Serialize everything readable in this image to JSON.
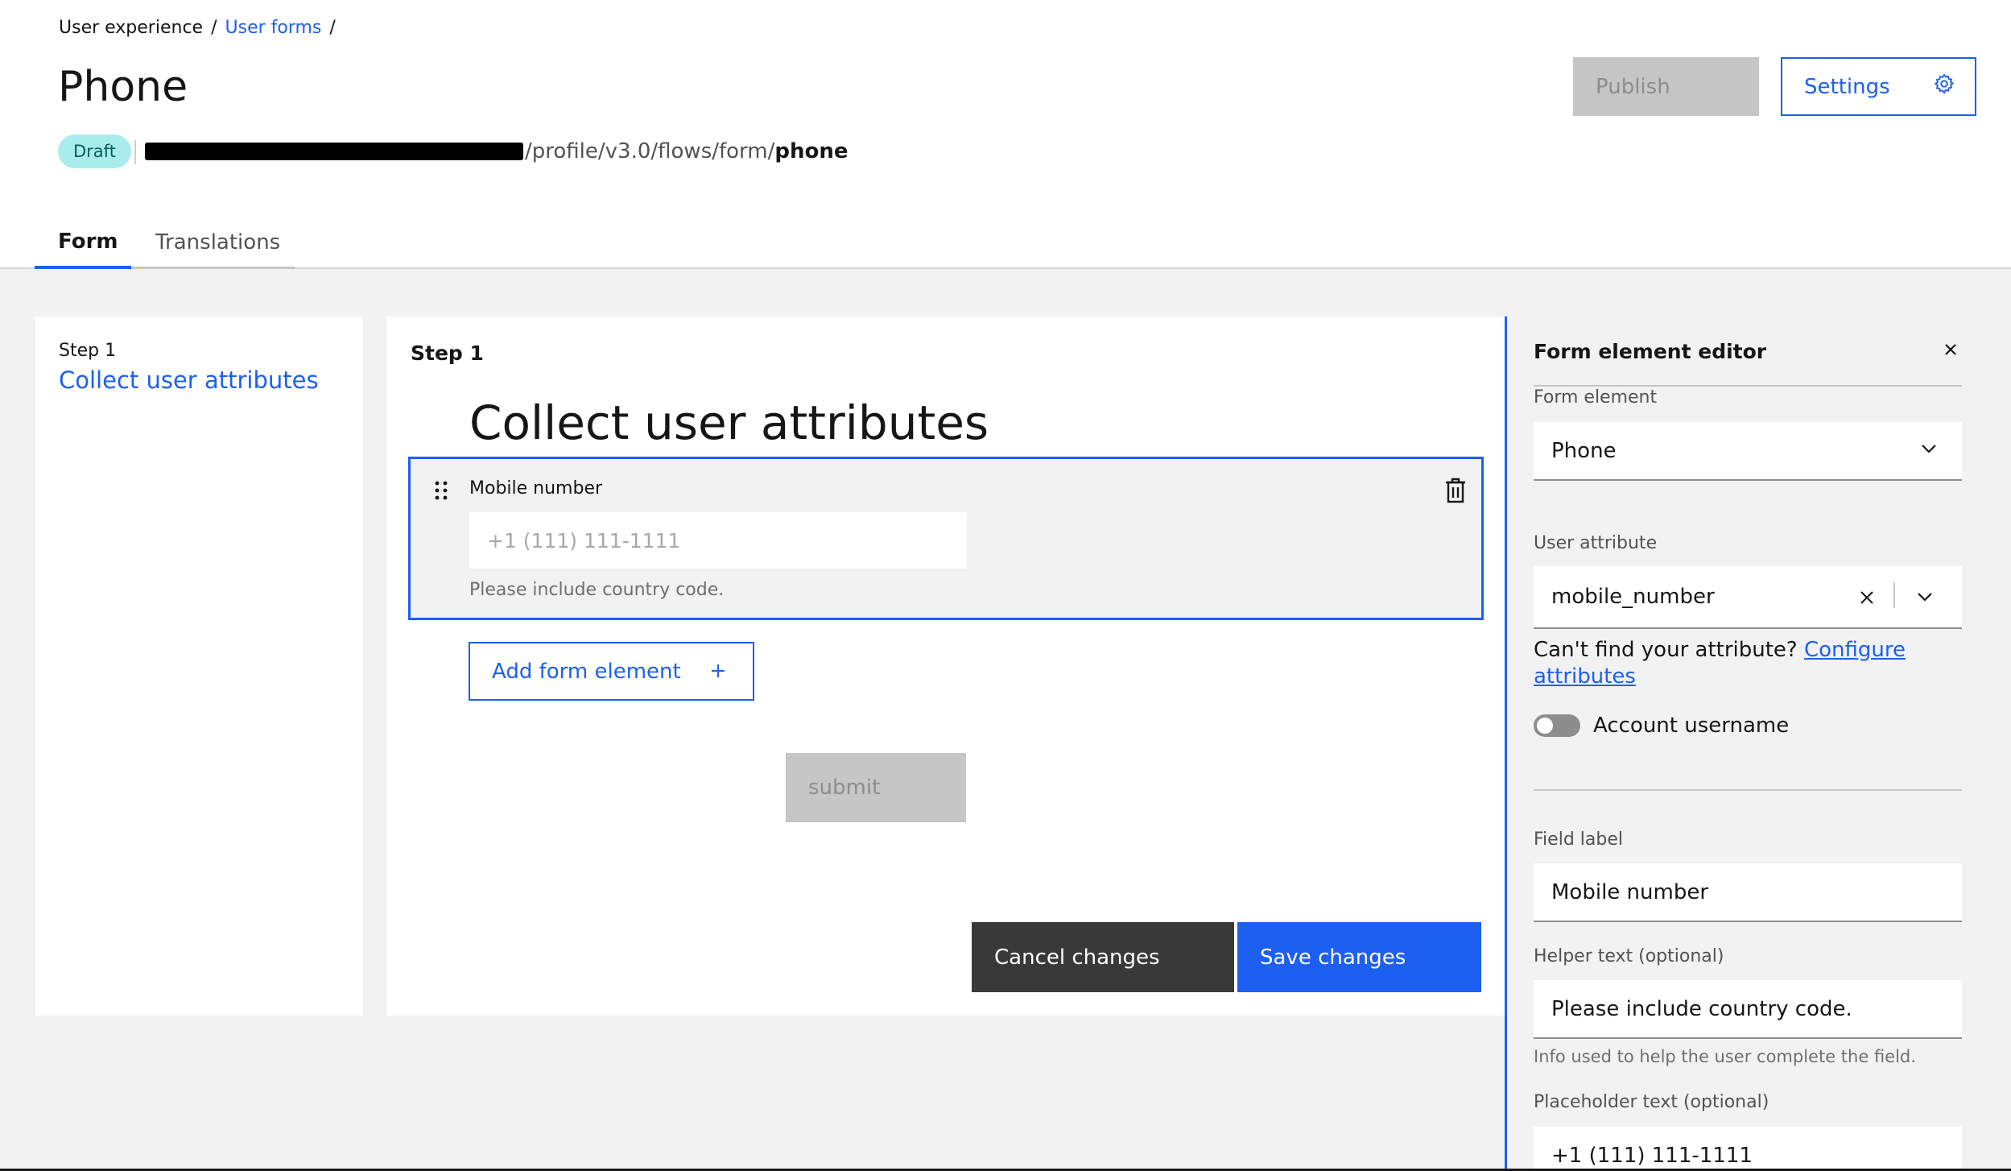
{
  "breadcrumb": {
    "root": "User experience",
    "link": "User forms",
    "separator": "/"
  },
  "page": {
    "title": "Phone",
    "status": "Draft",
    "url_suffix": "/profile/v3.0/flows/form/",
    "url_bold": "phone"
  },
  "header_actions": {
    "publish": "Publish",
    "settings": "Settings"
  },
  "tabs": [
    {
      "label": "Form",
      "active": true
    },
    {
      "label": "Translations",
      "active": false
    }
  ],
  "steps": {
    "step_label": "Step 1",
    "step_title": "Collect user attributes"
  },
  "canvas": {
    "step_label": "Step 1",
    "heading": "Collect user attributes",
    "field": {
      "label": "Mobile number",
      "placeholder": "+1 (111) 111-1111",
      "helper": "Please include country code."
    },
    "add_element": "Add form element",
    "submit": "submit",
    "cancel": "Cancel changes",
    "save": "Save changes"
  },
  "editor": {
    "title": "Form element editor",
    "form_element_label": "Form element",
    "form_element_value": "Phone",
    "user_attribute_label": "User attribute",
    "user_attribute_value": "mobile_number",
    "cant_find": "Can't find your attribute?",
    "configure_link": "Configure attributes",
    "toggle_label": "Account username",
    "toggle_on": false,
    "field_label_label": "Field label",
    "field_label_value": "Mobile number",
    "helper_label": "Helper text (optional)",
    "helper_value": "Please include country code.",
    "helper_note": "Info used to help the user complete the field.",
    "placeholder_label": "Placeholder text (optional)",
    "placeholder_value": "+1 (111) 111-1111"
  },
  "colors": {
    "accent": "#1d5ff0",
    "badge_bg": "#a8ecec",
    "dark_button": "#393939",
    "disabled": "#c6c6c6"
  }
}
